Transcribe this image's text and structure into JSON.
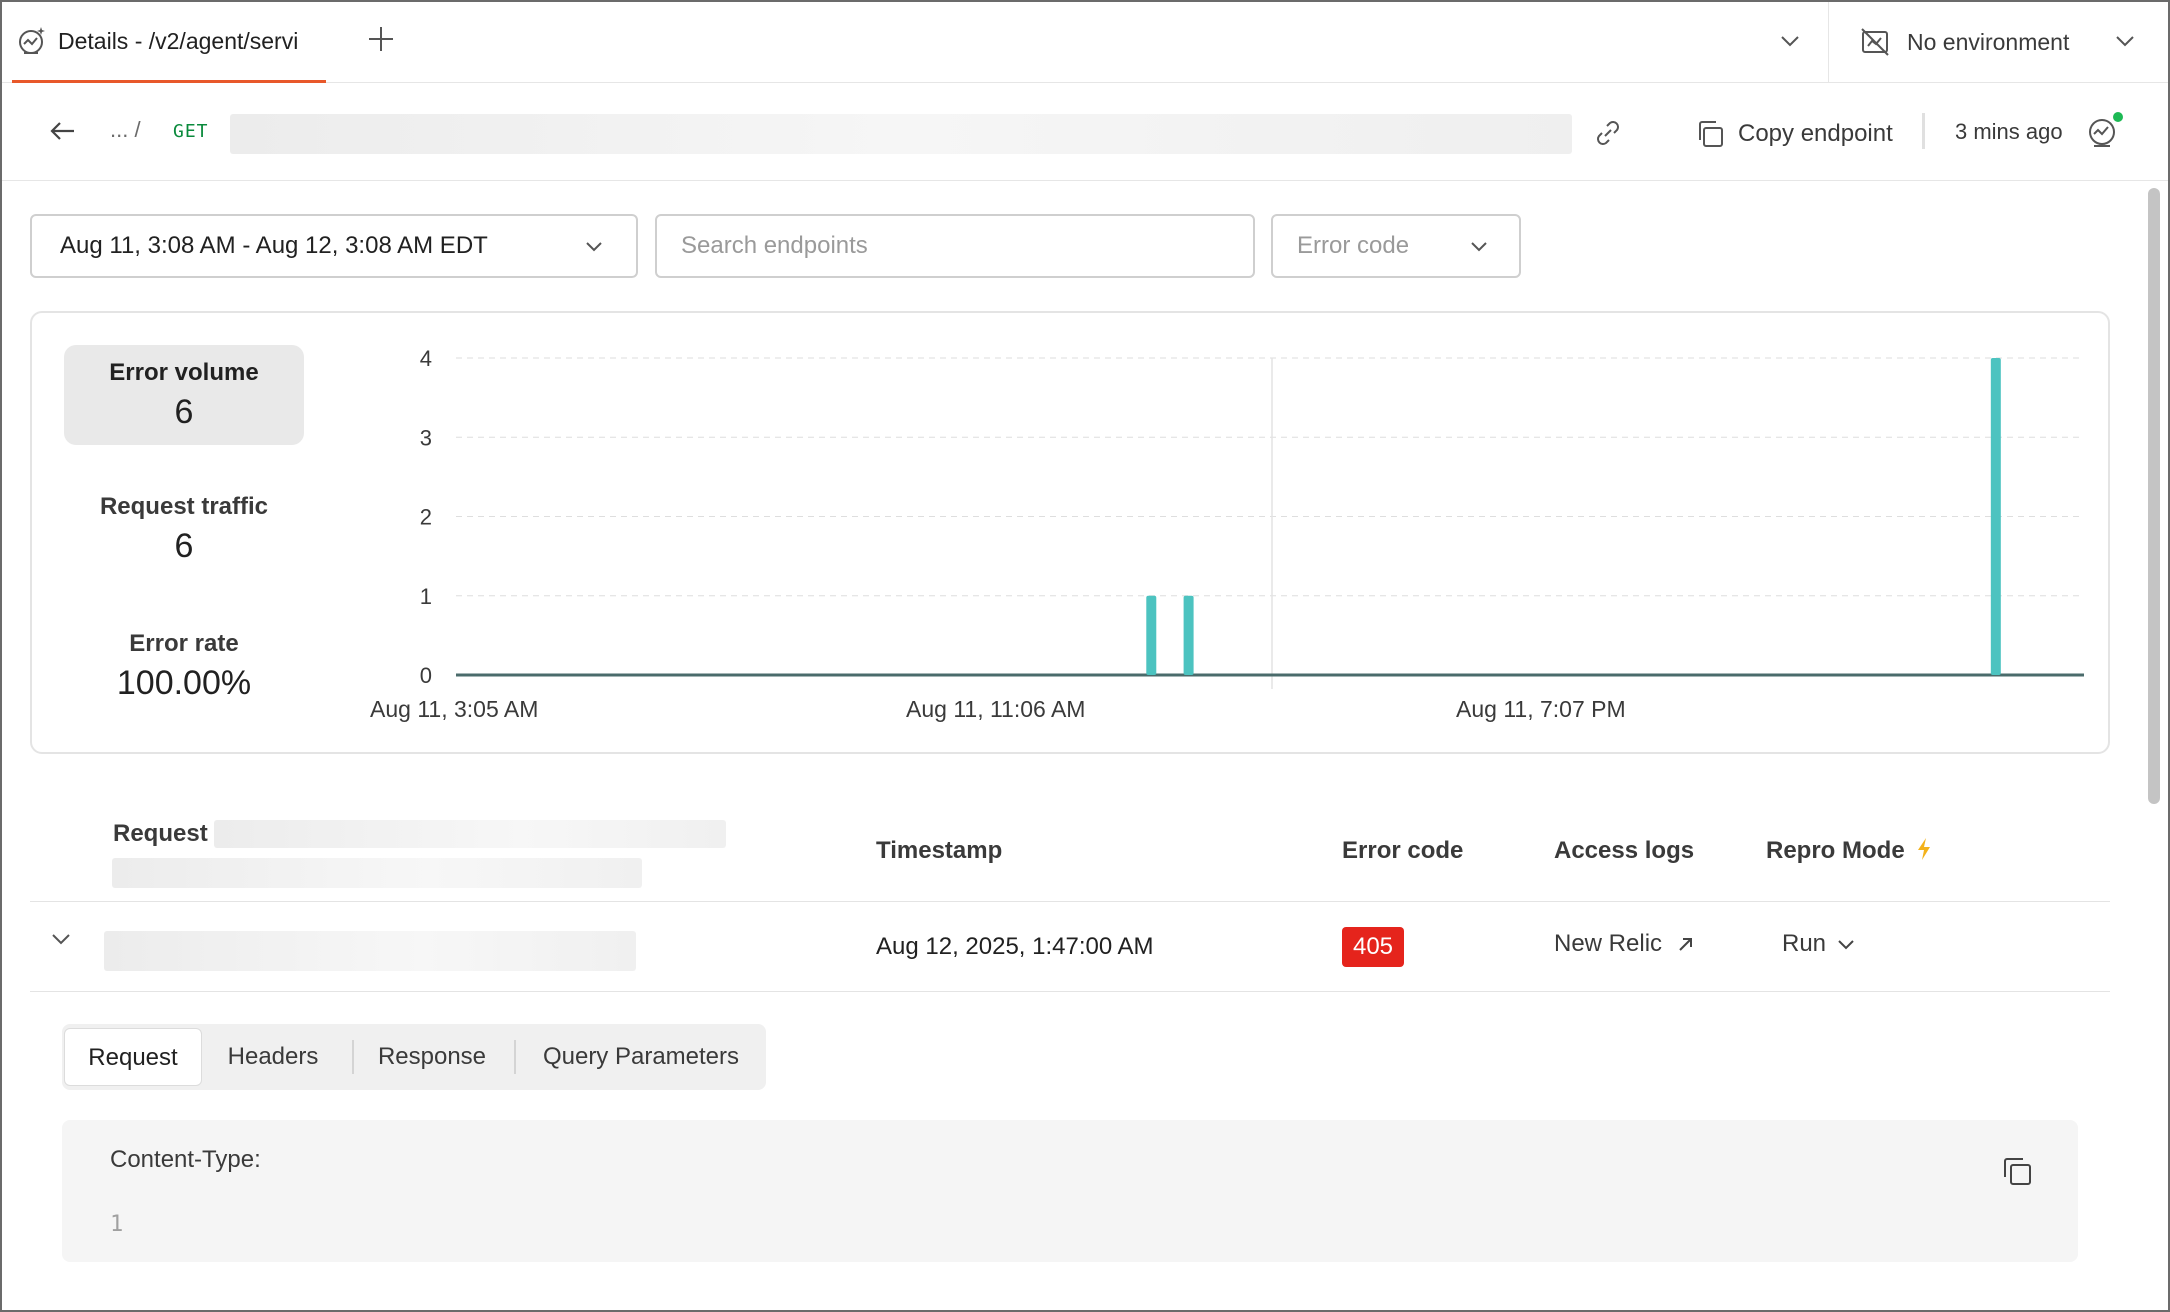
{
  "tab": {
    "title": "Details - /v2/agent/servi",
    "icon": "monitor-icon"
  },
  "environment": {
    "label": "No environment",
    "icon": "no-environment-icon"
  },
  "header": {
    "breadcrumb": "... /",
    "method": "GET",
    "copy_label": "Copy endpoint",
    "updated": "3 mins ago"
  },
  "filters": {
    "date_range": "Aug 11, 3:08 AM - Aug 12, 3:08 AM EDT",
    "search_placeholder": "Search endpoints",
    "error_code_placeholder": "Error code"
  },
  "metrics": [
    {
      "label": "Error volume",
      "value": "6"
    },
    {
      "label": "Request traffic",
      "value": "6"
    },
    {
      "label": "Error rate",
      "value": "100.00%"
    }
  ],
  "chart_data": {
    "type": "bar",
    "ylim": [
      0,
      4
    ],
    "yticks": [
      "0",
      "1",
      "2",
      "3",
      "4"
    ],
    "xtick_labels": [
      "Aug 11, 3:05 AM",
      "Aug 11, 11:06 AM",
      "Aug 11, 7:07 PM"
    ],
    "grid": "horizontal dashed",
    "bar_color": "#4cc3c0",
    "points": [
      {
        "time": "Aug 11, 1:20 PM",
        "value": 1
      },
      {
        "time": "Aug 11, 1:53 PM",
        "value": 1
      },
      {
        "time": "Aug 12, 1:47 AM",
        "value": 4
      }
    ]
  },
  "table": {
    "headers": {
      "request": "Request",
      "timestamp": "Timestamp",
      "error_code": "Error code",
      "access_logs": "Access logs",
      "repro_mode": "Repro Mode"
    },
    "rows": [
      {
        "timestamp": "Aug 12, 2025, 1:47:00 AM",
        "error_code": "405",
        "access_logs": "New Relic",
        "repro": "Run"
      }
    ]
  },
  "detail_tabs": [
    "Request",
    "Headers",
    "Response",
    "Query Parameters"
  ],
  "detail": {
    "content_type_label": "Content-Type:",
    "line_number": "1"
  },
  "colors": {
    "accent": "#e8582a",
    "error_badge": "#e5241c",
    "bar": "#4cc3c0",
    "method": "#0a8a3c"
  }
}
